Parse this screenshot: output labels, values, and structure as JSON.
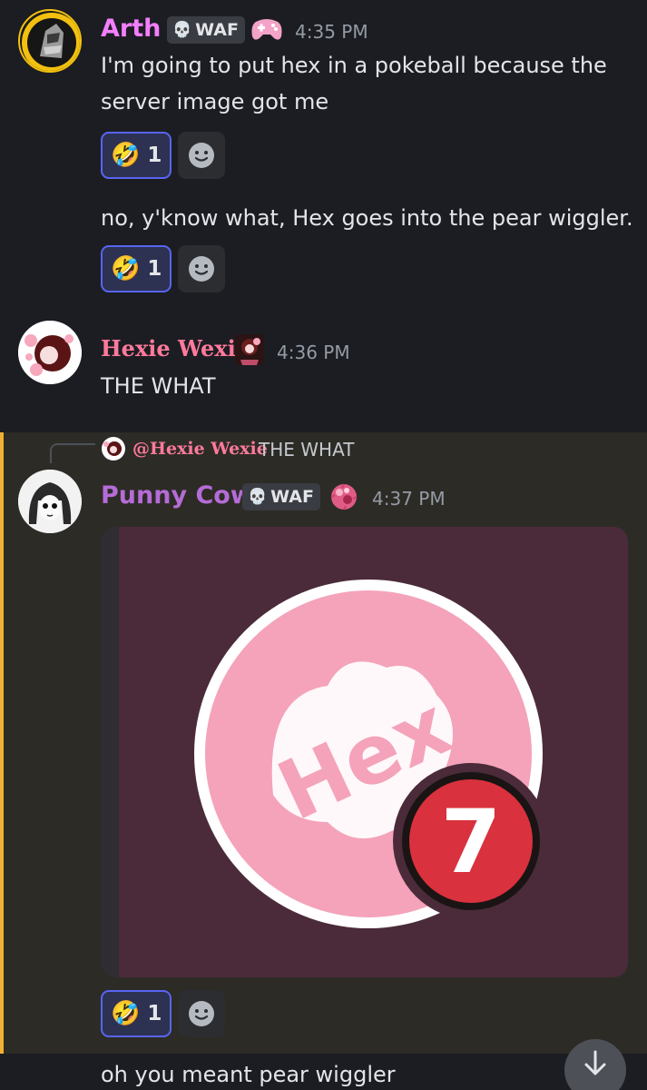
{
  "messages": [
    {
      "author": "Arth",
      "author_color": "#f47fff",
      "tag": "WAF",
      "time": "4:35 PM",
      "lines": [
        "I'm going to put hex in a pokeball because the",
        "server image got me"
      ],
      "reaction": {
        "emoji": "rolling-on-floor-laughing",
        "count": "1"
      },
      "followup": {
        "text": "no, y'know what, Hex goes into the pear wiggler.",
        "reaction": {
          "emoji": "rolling-on-floor-laughing",
          "count": "1"
        }
      }
    },
    {
      "author": "Hexie Wexie",
      "author_color": "#ff7a9c",
      "time": "4:36 PM",
      "text": "THE WHAT"
    },
    {
      "reply_to": {
        "author": "@Hexie Wexie",
        "text": "THE WHAT"
      },
      "author": "Punny Cow",
      "author_color": "#b46cd6",
      "tag": "WAF",
      "time": "4:37 PM",
      "attachment": {
        "badge_number": "7",
        "logo_text": "Hex"
      },
      "reaction": {
        "emoji": "rolling-on-floor-laughing",
        "count": "1"
      }
    },
    {
      "text": "oh you meant pear wiggler"
    }
  ],
  "colors": {
    "background": "#1c1d22",
    "highlight": "#2d2b26",
    "highlight_bar": "#f0b132",
    "reaction_active": "#5865f2",
    "attachment_bg": "#4b2b39",
    "logo_pink": "#f4a3ba",
    "badge_red": "#d9313d"
  }
}
